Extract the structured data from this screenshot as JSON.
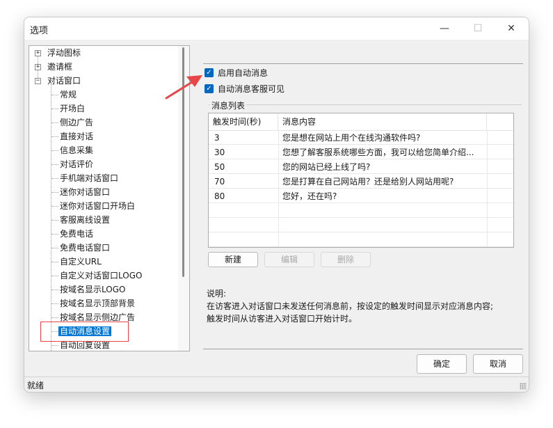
{
  "window": {
    "title": "选项",
    "minimize_glyph": "—",
    "maximize_glyph": "☐",
    "close_glyph": "✕"
  },
  "tree": {
    "expand_glyph": "+",
    "collapse_glyph": "−",
    "top_items": [
      "浮动图标",
      "邀请框",
      "对话窗口"
    ],
    "children": [
      "常规",
      "开场白",
      "侧边广告",
      "直接对话",
      "信息采集",
      "对话评价",
      "手机端对话窗口",
      "迷你对话窗口",
      "迷你对话窗口开场白",
      "客服离线设置",
      "免费电话",
      "免费电话窗口",
      "自定义URL",
      "自定义对话窗口LOGO",
      "按域名显示LOGO",
      "按域名显示顶部背景",
      "按域名显示侧边广告",
      "自动消息设置",
      "自动回复设置"
    ],
    "selected": "自动消息设置"
  },
  "options": {
    "enable_auto_message": "启用自动消息",
    "agent_visible": "自动消息客服可见",
    "check_glyph": "✓"
  },
  "message_list": {
    "group_title": "消息列表",
    "columns": [
      "触发时间(秒)",
      "消息内容"
    ],
    "rows": [
      {
        "time": "3",
        "content": "您是想在网站上用个在线沟通软件吗?"
      },
      {
        "time": "30",
        "content": " 您想了解客服系统哪些方面，我可以给您简单介绍..."
      },
      {
        "time": "50",
        "content": "您的网站已经上线了吗?"
      },
      {
        "time": "70",
        "content": "您是打算在自己网站用？还是给别人网站用呢?"
      },
      {
        "time": "80",
        "content": "您好，还在吗?"
      }
    ]
  },
  "buttons": {
    "new": "新建",
    "edit": "编辑",
    "delete": "删除",
    "ok": "确定",
    "cancel": "取消"
  },
  "notes": {
    "heading": "说明:",
    "line1": "在访客进入对话窗口未发送任何消息前，按设定的触发时间显示对应消息内容;",
    "line2": "触发时间从访客进入对话窗口开始计时。"
  },
  "status": {
    "text": "就绪"
  },
  "colors": {
    "accent": "#0067c0",
    "selection": "#0078d7",
    "annotation": "#e8474a"
  }
}
